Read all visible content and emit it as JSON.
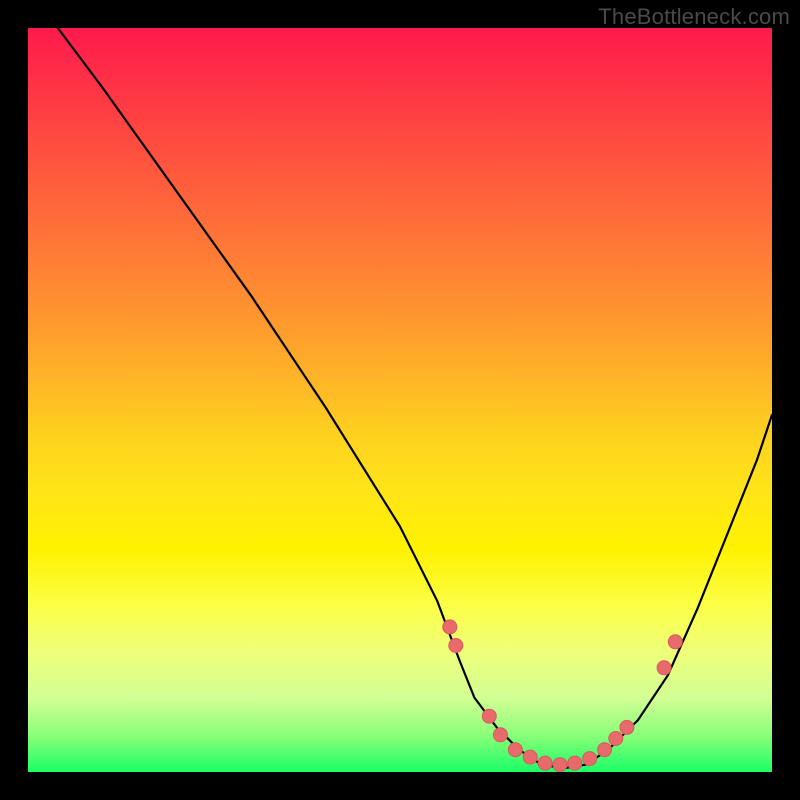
{
  "watermark": "TheBottleneck.com",
  "colors": {
    "frame": "#000000",
    "curve": "#000000",
    "marker_fill": "#e86a6a",
    "marker_stroke": "#d85a5a",
    "gradient_top": "#ff1a4d",
    "gradient_bottom": "#1aff66"
  },
  "chart_data": {
    "type": "line",
    "title": "",
    "xlabel": "",
    "ylabel": "",
    "xlim": [
      0,
      100
    ],
    "ylim": [
      0,
      100
    ],
    "grid": false,
    "legend": false,
    "series": [
      {
        "name": "curve",
        "x": [
          4,
          10,
          20,
          30,
          40,
          50,
          55,
          58,
          60,
          63,
          66,
          69,
          72,
          75,
          78,
          82,
          86,
          90,
          94,
          98,
          100
        ],
        "y": [
          100,
          92,
          78,
          64,
          49,
          33,
          23,
          15,
          10,
          6,
          3,
          1,
          0.5,
          1,
          3,
          7,
          13,
          22,
          32,
          42,
          48
        ]
      }
    ],
    "markers": [
      {
        "x": 56.7,
        "y": 19.5
      },
      {
        "x": 57.5,
        "y": 17.0
      },
      {
        "x": 62.0,
        "y": 7.5
      },
      {
        "x": 63.5,
        "y": 5.0
      },
      {
        "x": 65.5,
        "y": 3.0
      },
      {
        "x": 67.5,
        "y": 2.0
      },
      {
        "x": 69.5,
        "y": 1.2
      },
      {
        "x": 71.5,
        "y": 1.0
      },
      {
        "x": 73.5,
        "y": 1.2
      },
      {
        "x": 75.5,
        "y": 1.8
      },
      {
        "x": 77.5,
        "y": 3.0
      },
      {
        "x": 79.0,
        "y": 4.5
      },
      {
        "x": 80.5,
        "y": 6.0
      },
      {
        "x": 85.5,
        "y": 14.0
      },
      {
        "x": 87.0,
        "y": 17.5
      }
    ]
  }
}
